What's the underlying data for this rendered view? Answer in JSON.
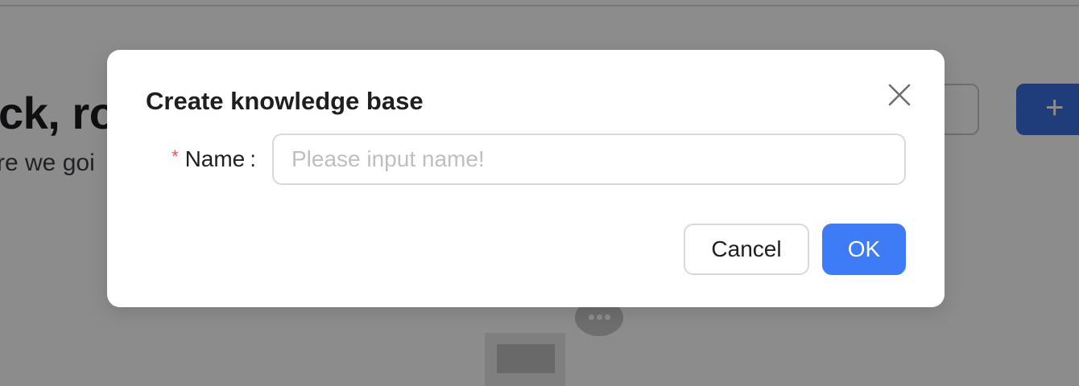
{
  "background": {
    "greeting": "ck, ro",
    "subtitle": "re we goi",
    "add_button_label": "+"
  },
  "modal": {
    "title": "Create knowledge base",
    "form": {
      "required_marker": "*",
      "name_label": "Name",
      "colon": ":",
      "name_placeholder": "Please input name!",
      "name_value": ""
    },
    "cancel_label": "Cancel",
    "ok_label": "OK"
  },
  "colors": {
    "primary": "#3d7bf7",
    "required": "#ff4d4f",
    "mask": "rgba(0,0,0,0.45)"
  },
  "icons": {
    "close": "close-icon",
    "add": "plus-icon",
    "empty": "empty-state-illustration"
  }
}
